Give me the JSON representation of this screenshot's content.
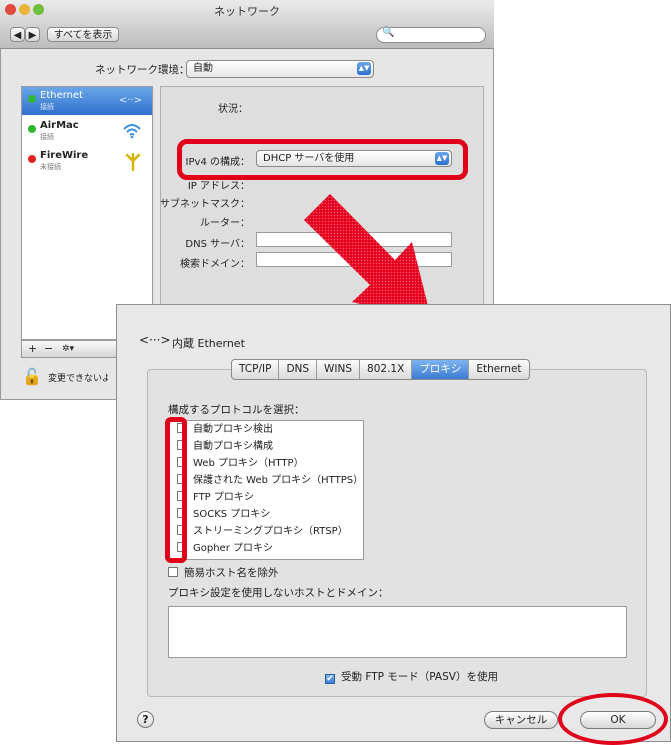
{
  "back_window": {
    "title": "ネットワーク",
    "nav_back": "◀",
    "nav_forward": "▶",
    "show_all": "すべてを表示",
    "location_label": "ネットワーク環境：",
    "location_value": "自動",
    "services": [
      {
        "name": "Ethernet",
        "status": "接続",
        "color": "#2fb52f",
        "icon": "<··>"
      },
      {
        "name": "AirMac",
        "status": "接続",
        "color": "#2fb52f",
        "icon": "wifi"
      },
      {
        "name": "FireWire",
        "status": "未接続",
        "color": "#e0261e",
        "icon": "firewire"
      }
    ],
    "list_buttons": [
      "+",
      "−",
      "✲▾"
    ],
    "status_label": "状況：",
    "ipv4_label": "IPv4 の構成：",
    "ipv4_value": "DHCP サーバを使用",
    "ip_label": "IP アドレス：",
    "subnet_label": "サブネットマスク：",
    "router_label": "ルーター：",
    "dns_label": "DNS サーバ：",
    "search_domain_label": "検索ドメイン：",
    "lock_text": "変更できないように"
  },
  "front_window": {
    "title": "内蔵 Ethernet",
    "tabs": [
      "TCP/IP",
      "DNS",
      "WINS",
      "802.1X",
      "プロキシ",
      "Ethernet"
    ],
    "selected_tab": "プロキシ",
    "protocols_heading": "構成するプロトコルを選択：",
    "protocols": [
      "自動プロキシ検出",
      "自動プロキシ構成",
      "Web プロキシ（HTTP）",
      "保護された Web プロキシ（HTTPS）",
      "FTP プロキシ",
      "SOCKS プロキシ",
      "ストリーミングプロキシ（RTSP）",
      "Gopher プロキシ"
    ],
    "simple_hostnames": "簡易ホスト名を除外",
    "bypass_label": "プロキシ設定を使用しないホストとドメイン：",
    "pasv_label": "受動 FTP モード（PASV）を使用",
    "help": "?",
    "cancel": "キャンセル",
    "ok": "OK"
  },
  "colors": {
    "highlight": "#e0001a",
    "select_blue": "#3a7bd5"
  }
}
